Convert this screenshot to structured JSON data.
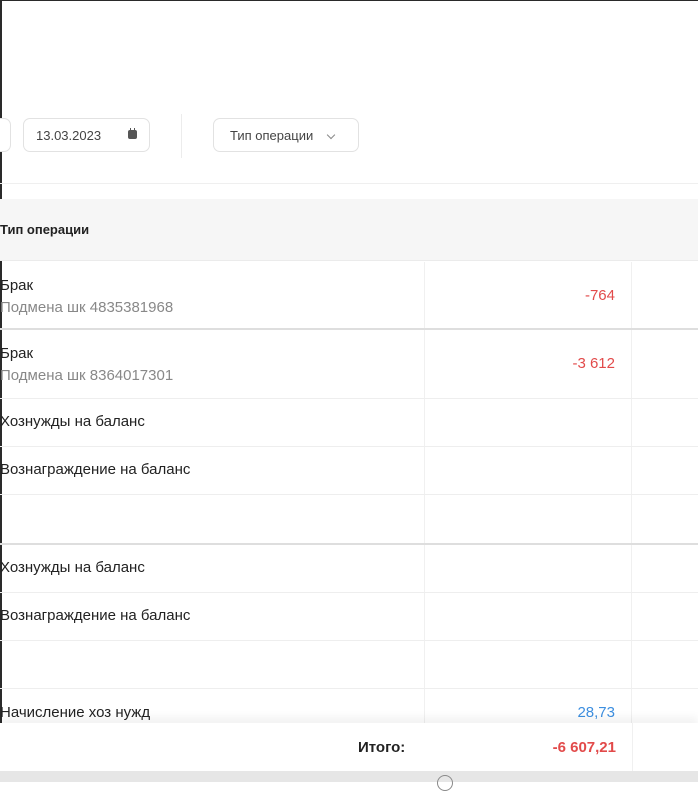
{
  "filters": {
    "date_value": "13.03.2023",
    "calendar_icon": "calendar-icon",
    "operation_type_label": "Тип операции",
    "chevron_icon": "chevron-down-icon"
  },
  "table": {
    "header": {
      "operation_type": "Тип операции"
    },
    "rows": [
      {
        "name": "Брак",
        "sub": "Подмена шк 4835381968",
        "amount": "-764"
      },
      {
        "name": "Брак",
        "sub": "Подмена шк 8364017301",
        "amount": "-3 612"
      },
      {
        "name": "Хознужды на баланс",
        "amount": ""
      },
      {
        "name": "Вознаграждение на баланс",
        "amount": ""
      },
      {
        "name": "",
        "amount": ""
      },
      {
        "name": "Хознужды на баланс",
        "amount": ""
      },
      {
        "name": "Вознаграждение на баланс",
        "amount": ""
      },
      {
        "name": "",
        "amount": ""
      },
      {
        "name": "Начисление хоз нужд",
        "amount": "28,73"
      }
    ]
  },
  "total": {
    "label": "Итого:",
    "value": "-6 607,21"
  },
  "colors": {
    "negative": "#e24a4a",
    "positive": "#3d8fe0"
  }
}
